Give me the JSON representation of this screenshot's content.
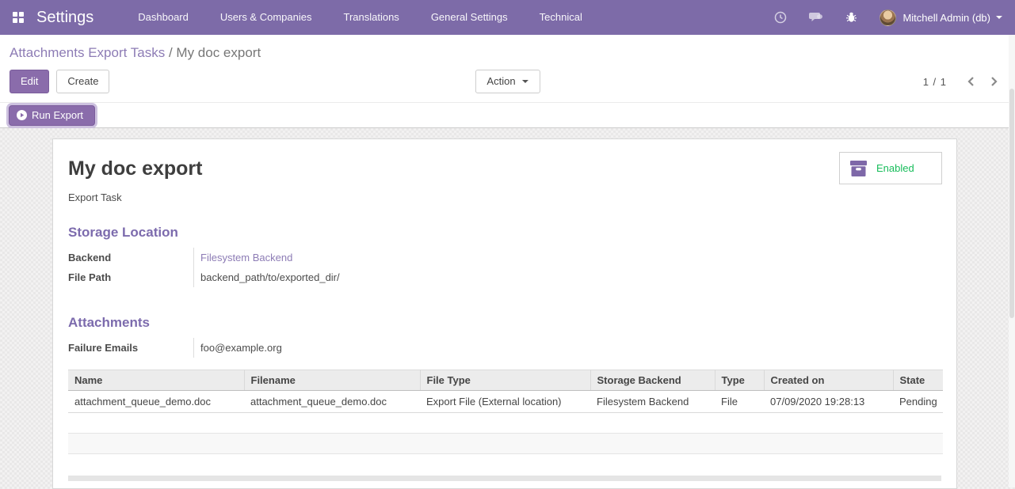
{
  "colors": {
    "navbar_bg": "#7d6ba8",
    "accent_purple": "#7c6bad",
    "link_purple": "#8d7cb5",
    "button_purple": "#8a6cab",
    "success_green": "#18bd5b"
  },
  "navbar": {
    "app_title": "Settings",
    "menu": [
      "Dashboard",
      "Users & Companies",
      "Translations",
      "General Settings",
      "Technical"
    ],
    "icons": {
      "apps": "grid-2x2",
      "activity": "clock",
      "messages": "chat-bubble",
      "debug": "bug",
      "user_caret": "caret-down"
    },
    "user": {
      "name": "Mitchell Admin (db)"
    }
  },
  "breadcrumb": {
    "parent": "Attachments Export Tasks",
    "separator": "/",
    "current": "My doc export"
  },
  "control_panel": {
    "edit_label": "Edit",
    "create_label": "Create",
    "action_label": "Action",
    "pager_count": "1 / 1",
    "pager_icons": {
      "prev": "chevron-left",
      "next": "chevron-right"
    }
  },
  "statusbar": {
    "run_export_label": "Run Export",
    "run_export_icon": "play-circle"
  },
  "sheet": {
    "title": "My doc export",
    "subtitle": "Export Task",
    "stat_button": {
      "label": "Enabled",
      "icon": "archive-box"
    },
    "storage_section": {
      "heading": "Storage Location",
      "backend_label": "Backend",
      "backend_value": "Filesystem Backend",
      "file_path_label": "File Path",
      "file_path_value": "backend_path/to/exported_dir/"
    },
    "attachments_section": {
      "heading": "Attachments",
      "failure_emails_label": "Failure Emails",
      "failure_emails_value": "foo@example.org",
      "table": {
        "headers": [
          "Name",
          "Filename",
          "File Type",
          "Storage Backend",
          "Type",
          "Created on",
          "State"
        ],
        "rows": [
          [
            "attachment_queue_demo.doc",
            "attachment_queue_demo.doc",
            "Export File (External location)",
            "Filesystem Backend",
            "File",
            "07/09/2020 19:28:13",
            "Pending"
          ]
        ]
      }
    }
  }
}
